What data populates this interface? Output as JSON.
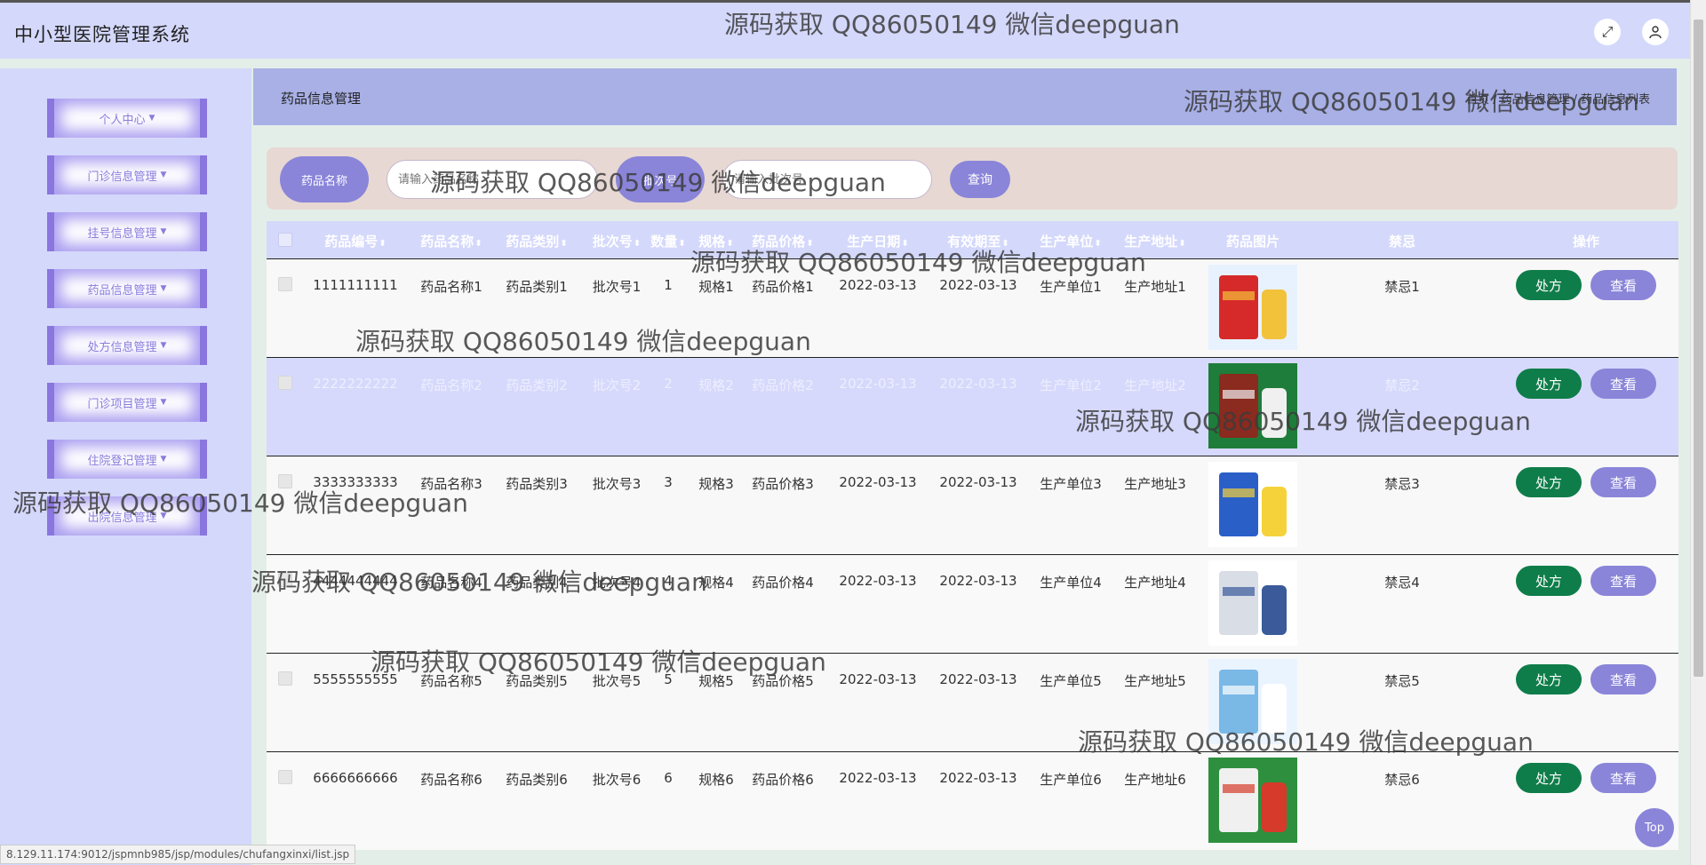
{
  "app": {
    "title": "中小型医院管理系统"
  },
  "topbar": {
    "fullscreen_icon": "expand-icon",
    "user_icon": "user-icon"
  },
  "sidebar": {
    "items": [
      {
        "label": "个人中心"
      },
      {
        "label": "门诊信息管理"
      },
      {
        "label": "挂号信息管理"
      },
      {
        "label": "药品信息管理"
      },
      {
        "label": "处方信息管理"
      },
      {
        "label": "门诊项目管理"
      },
      {
        "label": "住院登记管理"
      },
      {
        "label": "出院信息管理"
      }
    ]
  },
  "header": {
    "section_title": "药品信息管理",
    "breadcrumb": [
      "首页",
      "药品信息管理",
      "药品信息列表"
    ]
  },
  "search": {
    "field1_label": "药品名称",
    "field1_placeholder": "请输入药品名称",
    "field2_label": "批次号",
    "field2_placeholder": "请输入批次号",
    "query_label": "查询"
  },
  "table": {
    "headers": {
      "code": "药品编号",
      "name": "药品名称",
      "category": "药品类别",
      "batch": "批次号",
      "qty": "数量",
      "spec": "规格",
      "price": "药品价格",
      "prod_date": "生产日期",
      "expiry": "有效期至",
      "maker": "生产单位",
      "address": "生产地址",
      "image": "药品图片",
      "taboo": "禁忌",
      "ops": "操作"
    },
    "rows": [
      {
        "code": "1111111111",
        "name": "药品名称1",
        "category": "药品类别1",
        "batch": "批次号1",
        "qty": "1",
        "spec": "规格1",
        "price": "药品价格1",
        "prod_date": "2022-03-13",
        "expiry": "2022-03-13",
        "maker": "生产单位1",
        "address": "生产地址1",
        "taboo": "禁忌1",
        "rx": "处方",
        "view": "查看"
      },
      {
        "code": "2222222222",
        "name": "药品名称2",
        "category": "药品类别2",
        "batch": "批次号2",
        "qty": "2",
        "spec": "规格2",
        "price": "药品价格2",
        "prod_date": "2022-03-13",
        "expiry": "2022-03-13",
        "maker": "生产单位2",
        "address": "生产地址2",
        "taboo": "禁忌2",
        "rx": "处方",
        "view": "查看"
      },
      {
        "code": "3333333333",
        "name": "药品名称3",
        "category": "药品类别3",
        "batch": "批次号3",
        "qty": "3",
        "spec": "规格3",
        "price": "药品价格3",
        "prod_date": "2022-03-13",
        "expiry": "2022-03-13",
        "maker": "生产单位3",
        "address": "生产地址3",
        "taboo": "禁忌3",
        "rx": "处方",
        "view": "查看"
      },
      {
        "code": "4444444444",
        "name": "药品名称4",
        "category": "药品类别4",
        "batch": "批次号4",
        "qty": "4",
        "spec": "规格4",
        "price": "药品价格4",
        "prod_date": "2022-03-13",
        "expiry": "2022-03-13",
        "maker": "生产单位4",
        "address": "生产地址4",
        "taboo": "禁忌4",
        "rx": "处方",
        "view": "查看"
      },
      {
        "code": "5555555555",
        "name": "药品名称5",
        "category": "药品类别5",
        "batch": "批次号5",
        "qty": "5",
        "spec": "规格5",
        "price": "药品价格5",
        "prod_date": "2022-03-13",
        "expiry": "2022-03-13",
        "maker": "生产单位5",
        "address": "生产地址5",
        "taboo": "禁忌5",
        "rx": "处方",
        "view": "查看"
      },
      {
        "code": "6666666666",
        "name": "药品名称6",
        "category": "药品类别6",
        "batch": "批次号6",
        "qty": "6",
        "spec": "规格6",
        "price": "药品价格6",
        "prod_date": "2022-03-13",
        "expiry": "2022-03-13",
        "maker": "生产单位6",
        "address": "生产地址6",
        "taboo": "禁忌6",
        "rx": "处方",
        "view": "查看"
      }
    ]
  },
  "watermark": "源码获取 QQ86050149 微信deepguan",
  "status_url": "8.129.11.174:9012/jspmnb985/jsp/modules/chufangxinxi/list.jsp",
  "top_button": "Top",
  "colors": {
    "accent": "#8a85d9",
    "rx_button": "#0f7d4a",
    "sidebar_bg": "#d4d8fb",
    "header_bar": "#a8b0e6"
  }
}
